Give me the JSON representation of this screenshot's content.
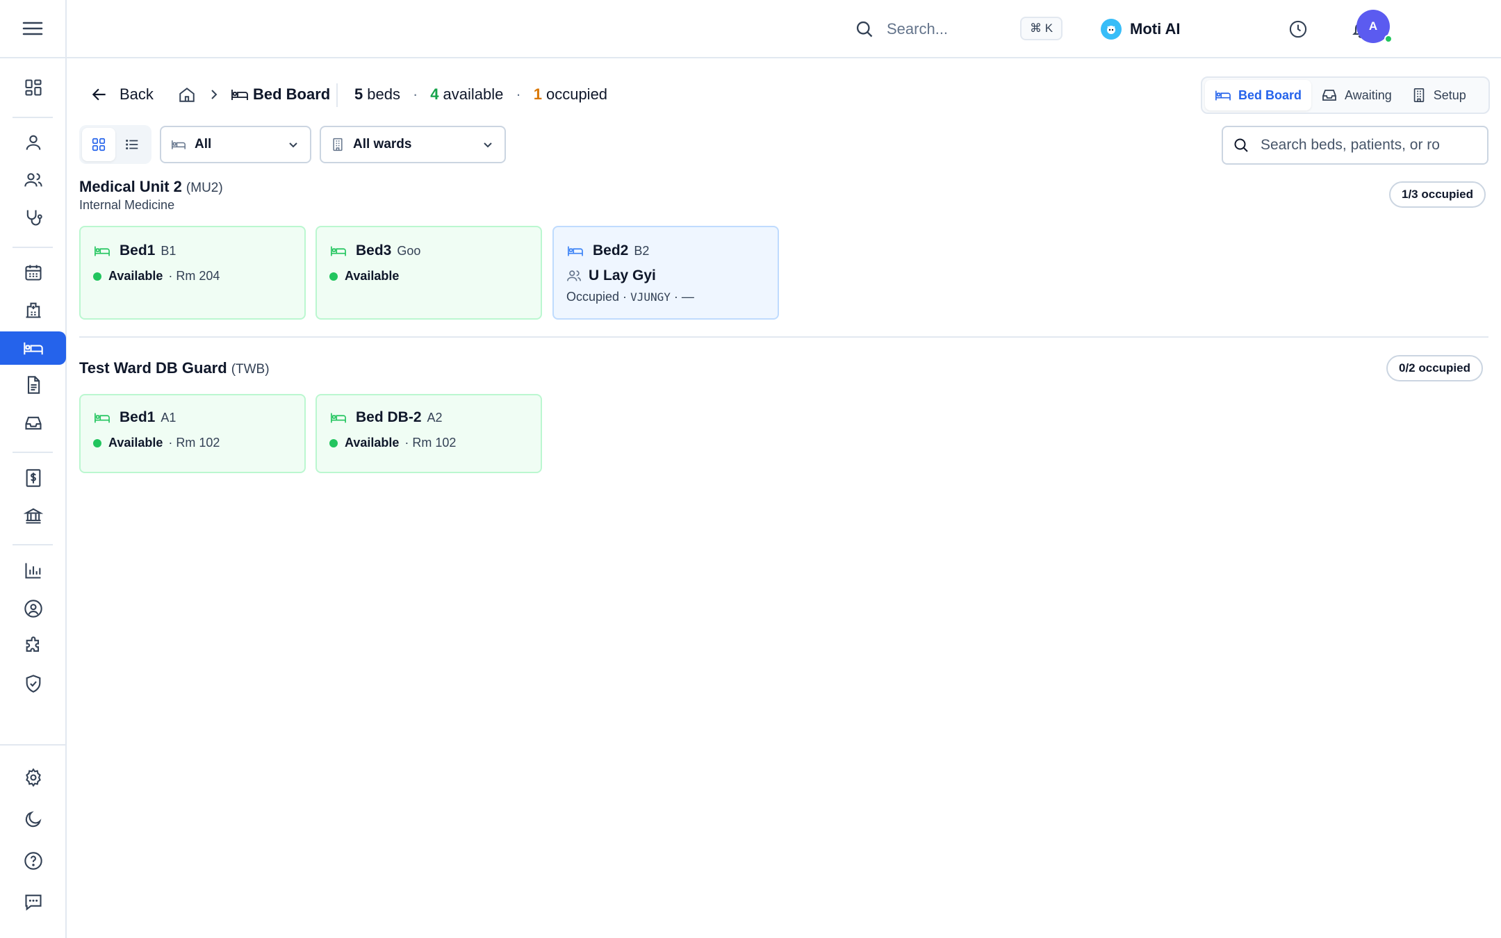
{
  "topbar": {
    "search_placeholder": "Search...",
    "shortcut": "⌘ K",
    "ai_label": "Moti AI",
    "avatar_initial": "A"
  },
  "header": {
    "back_label": "Back",
    "breadcrumb_title": "Bed Board",
    "stats": {
      "beds_count": "5",
      "beds_label": "beds",
      "available_count": "4",
      "available_label": "available",
      "occupied_count": "1",
      "occupied_label": "occupied",
      "separator": "·"
    }
  },
  "tabs": {
    "bed_board": "Bed Board",
    "awaiting": "Awaiting",
    "setup": "Setup"
  },
  "filters": {
    "status_value": "All",
    "ward_value": "All wards",
    "search_placeholder": "Search beds, patients, or ro"
  },
  "wards": [
    {
      "name": "Medical Unit 2",
      "code": "(MU2)",
      "department": "Internal Medicine",
      "occupancy": "1/3 occupied",
      "beds": [
        {
          "name": "Bed1",
          "code": "B1",
          "status": "Available",
          "room": "· Rm 204"
        },
        {
          "name": "Bed3",
          "code": "Goo",
          "status": "Available",
          "room": ""
        },
        {
          "name": "Bed2",
          "code": "B2",
          "patient": "U Lay Gyi",
          "status_prefix": "Occupied ·",
          "patient_code": "VJUNGY",
          "status_suffix": "· —"
        }
      ]
    },
    {
      "name": "Test Ward DB Guard",
      "code": "(TWB)",
      "occupancy": "0/2 occupied",
      "beds": [
        {
          "name": "Bed1",
          "code": "A1",
          "status": "Available",
          "room": "· Rm 102"
        },
        {
          "name": "Bed DB-2",
          "code": "A2",
          "status": "Available",
          "room": "· Rm 102"
        }
      ]
    }
  ],
  "colors": {
    "accent": "#2563eb",
    "available": "#22c55e",
    "occupied_count": "#d97706",
    "available_card_bg": "#f0fdf4",
    "occupied_card_bg": "#eff6ff"
  }
}
